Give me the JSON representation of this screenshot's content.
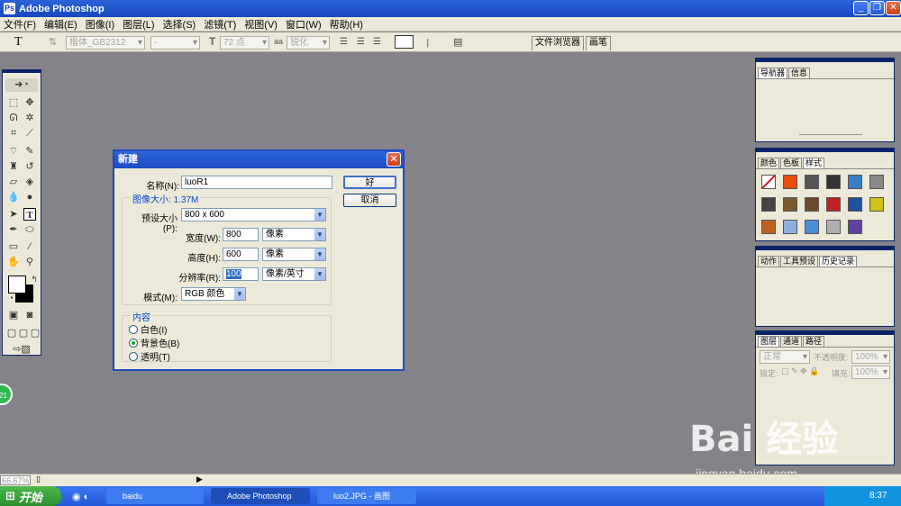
{
  "app": {
    "title": "Adobe Photoshop"
  },
  "window_buttons": {
    "minimize": "_",
    "restore": "❐",
    "close": "✕"
  },
  "menu": [
    "文件(F)",
    "编辑(E)",
    "图像(I)",
    "图层(L)",
    "选择(S)",
    "滤镜(T)",
    "视图(V)",
    "窗口(W)",
    "帮助(H)"
  ],
  "options": {
    "tool_icon": "T",
    "font_family": "楷体_GB2312",
    "font_style": "-",
    "font_size": "72 点",
    "aa_prefix": "aa",
    "antialias": "锐化",
    "palette_tabs": [
      "文件浏览器",
      "画笔"
    ]
  },
  "dialog": {
    "title": "新建",
    "name_label": "名称(N):",
    "name_value": "luoR1",
    "ok": "好",
    "cancel": "取消",
    "image_size_label": "图像大小: 1.37M",
    "preset_label": "预设大小(P):",
    "preset_value": "800 x 600",
    "width_label": "宽度(W):",
    "width_value": "800",
    "width_unit": "像素",
    "height_label": "高度(H):",
    "height_value": "600",
    "height_unit": "像素",
    "resolution_label": "分辨率(R):",
    "resolution_value": "100",
    "resolution_unit": "像素/英寸",
    "mode_label": "模式(M):",
    "mode_value": "RGB 颜色",
    "contents_label": "内容",
    "contents_options": [
      "白色(I)",
      "背景色(B)",
      "透明(T)"
    ],
    "contents_selected": 1
  },
  "panels": {
    "navigator_tabs": [
      "导航器",
      "信息"
    ],
    "color_tabs": [
      "颜色",
      "色板",
      "样式"
    ],
    "history_tabs": [
      "动作",
      "工具预设",
      "历史记录"
    ],
    "layers_tabs": [
      "图层",
      "通道",
      "路径"
    ],
    "layers": {
      "blend_mode": "正常",
      "opacity_label": "不透明度:",
      "opacity": "100%",
      "lock_label": "锁定:",
      "fill_label": "填充:",
      "fill": "100%"
    },
    "style_colors": [
      "#ffffff",
      "#e84a10",
      "#555555",
      "#333333",
      "#3a7ec8",
      "#888888",
      "#444444",
      "#7a5a30",
      "#6a4a2a",
      "#c02020",
      "#2050a0",
      "#d0c020",
      "#c06020",
      "#8ab0e0",
      "#4a90d8",
      "#b0b0b0",
      "#6040a0"
    ]
  },
  "status": {
    "zoom": "66.67%"
  },
  "badge": "21",
  "taskbar": {
    "start": "开始",
    "items": [
      "baidu",
      "Adobe Photoshop",
      "luo2.JPG - 画图"
    ],
    "time": "8:37"
  },
  "watermark": {
    "main": "Bai 经验",
    "sub": "jingyan.baidu.com"
  }
}
